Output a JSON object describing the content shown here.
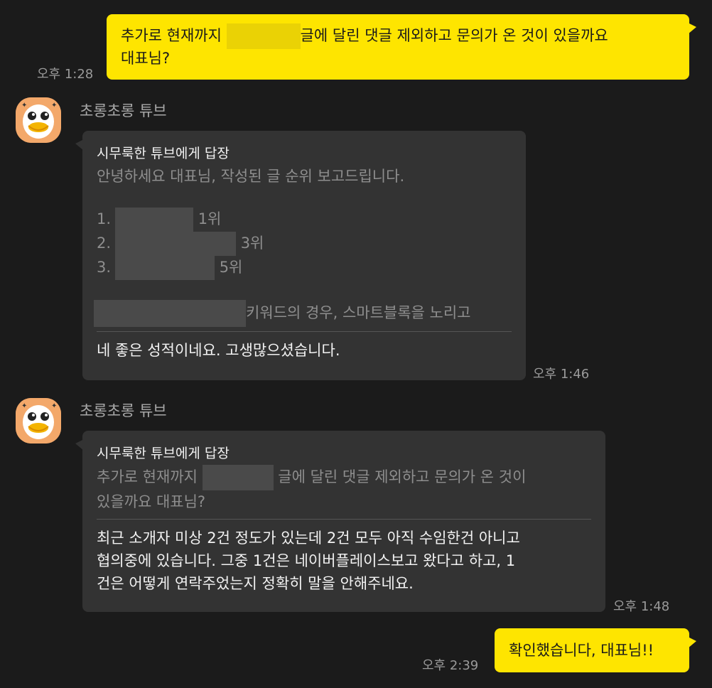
{
  "messages": {
    "m1": {
      "text_before": "추가로 현재까지 ",
      "text_after": "글에 달린 댓글 제외하고 문의가 온 것이 있을까요",
      "text_line2": "대표님?",
      "time": "오후 1:28"
    },
    "m2": {
      "sender": "초롱초롱 튜브",
      "reply_header": "시무룩한 튜브에게 답장",
      "quote_line1": "안녕하세요 대표님, 작성된 글 순위 보고드립니다.",
      "list": [
        {
          "num": "1.",
          "rank": "1위"
        },
        {
          "num": "2.",
          "rank": "3위"
        },
        {
          "num": "3.",
          "rank": "5위"
        }
      ],
      "quote_keyword": "키워드의 경우, 스마트블록을 노리고",
      "body": "네 좋은 성적이네요. 고생많으셨습니다.",
      "time": "오후 1:46"
    },
    "m3": {
      "sender": "초롱초롱 튜브",
      "reply_header": "시무룩한 튜브에게 답장",
      "quote_before": "추가로 현재까지 ",
      "quote_after": " 글에 달린 댓글 제외하고 문의가 온 것이",
      "quote_line2": "있을까요 대표님?",
      "body_line1": "최근 소개자 미상 2건 정도가 있는데 2건 모두 아직 수임한건 아니고",
      "body_line2": "협의중에 있습니다. 그중 1건은 네이버플레이스보고 왔다고 하고, 1",
      "body_line3": "건은 어떻게 연락주었는지 정확히 말을 안해주네요.",
      "time": "오후 1:48"
    },
    "m4": {
      "text": "확인했습니다, 대표님!!",
      "time": "오후 2:39"
    }
  },
  "colors": {
    "background": "#1b1b1b",
    "my_bubble": "#fee500",
    "other_bubble": "#333333",
    "timestamp": "#9a9a9a"
  },
  "icons": {
    "avatar": "tube-character-avatar"
  }
}
